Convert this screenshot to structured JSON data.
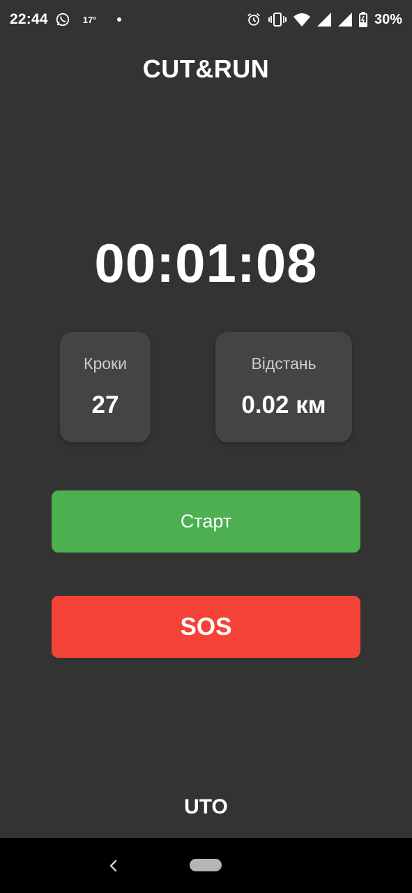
{
  "status_bar": {
    "time": "22:44",
    "temperature": "17°",
    "battery_percent": "30%",
    "icons": [
      "whatsapp-icon",
      "alarm-icon",
      "vibrate-icon",
      "wifi-icon",
      "signal-icon",
      "signal-icon",
      "battery-icon"
    ]
  },
  "app": {
    "title": "CUT&RUN"
  },
  "timer": {
    "value": "00:01:08"
  },
  "stats": {
    "steps": {
      "label": "Кроки",
      "value": "27"
    },
    "distance": {
      "label": "Відстань",
      "value": "0.02 км"
    }
  },
  "buttons": {
    "start_label": "Старт",
    "sos_label": "SOS"
  },
  "footer": {
    "label": "UTO"
  },
  "colors": {
    "background": "#333333",
    "card": "#444444",
    "start": "#4caf50",
    "sos": "#f44336"
  }
}
